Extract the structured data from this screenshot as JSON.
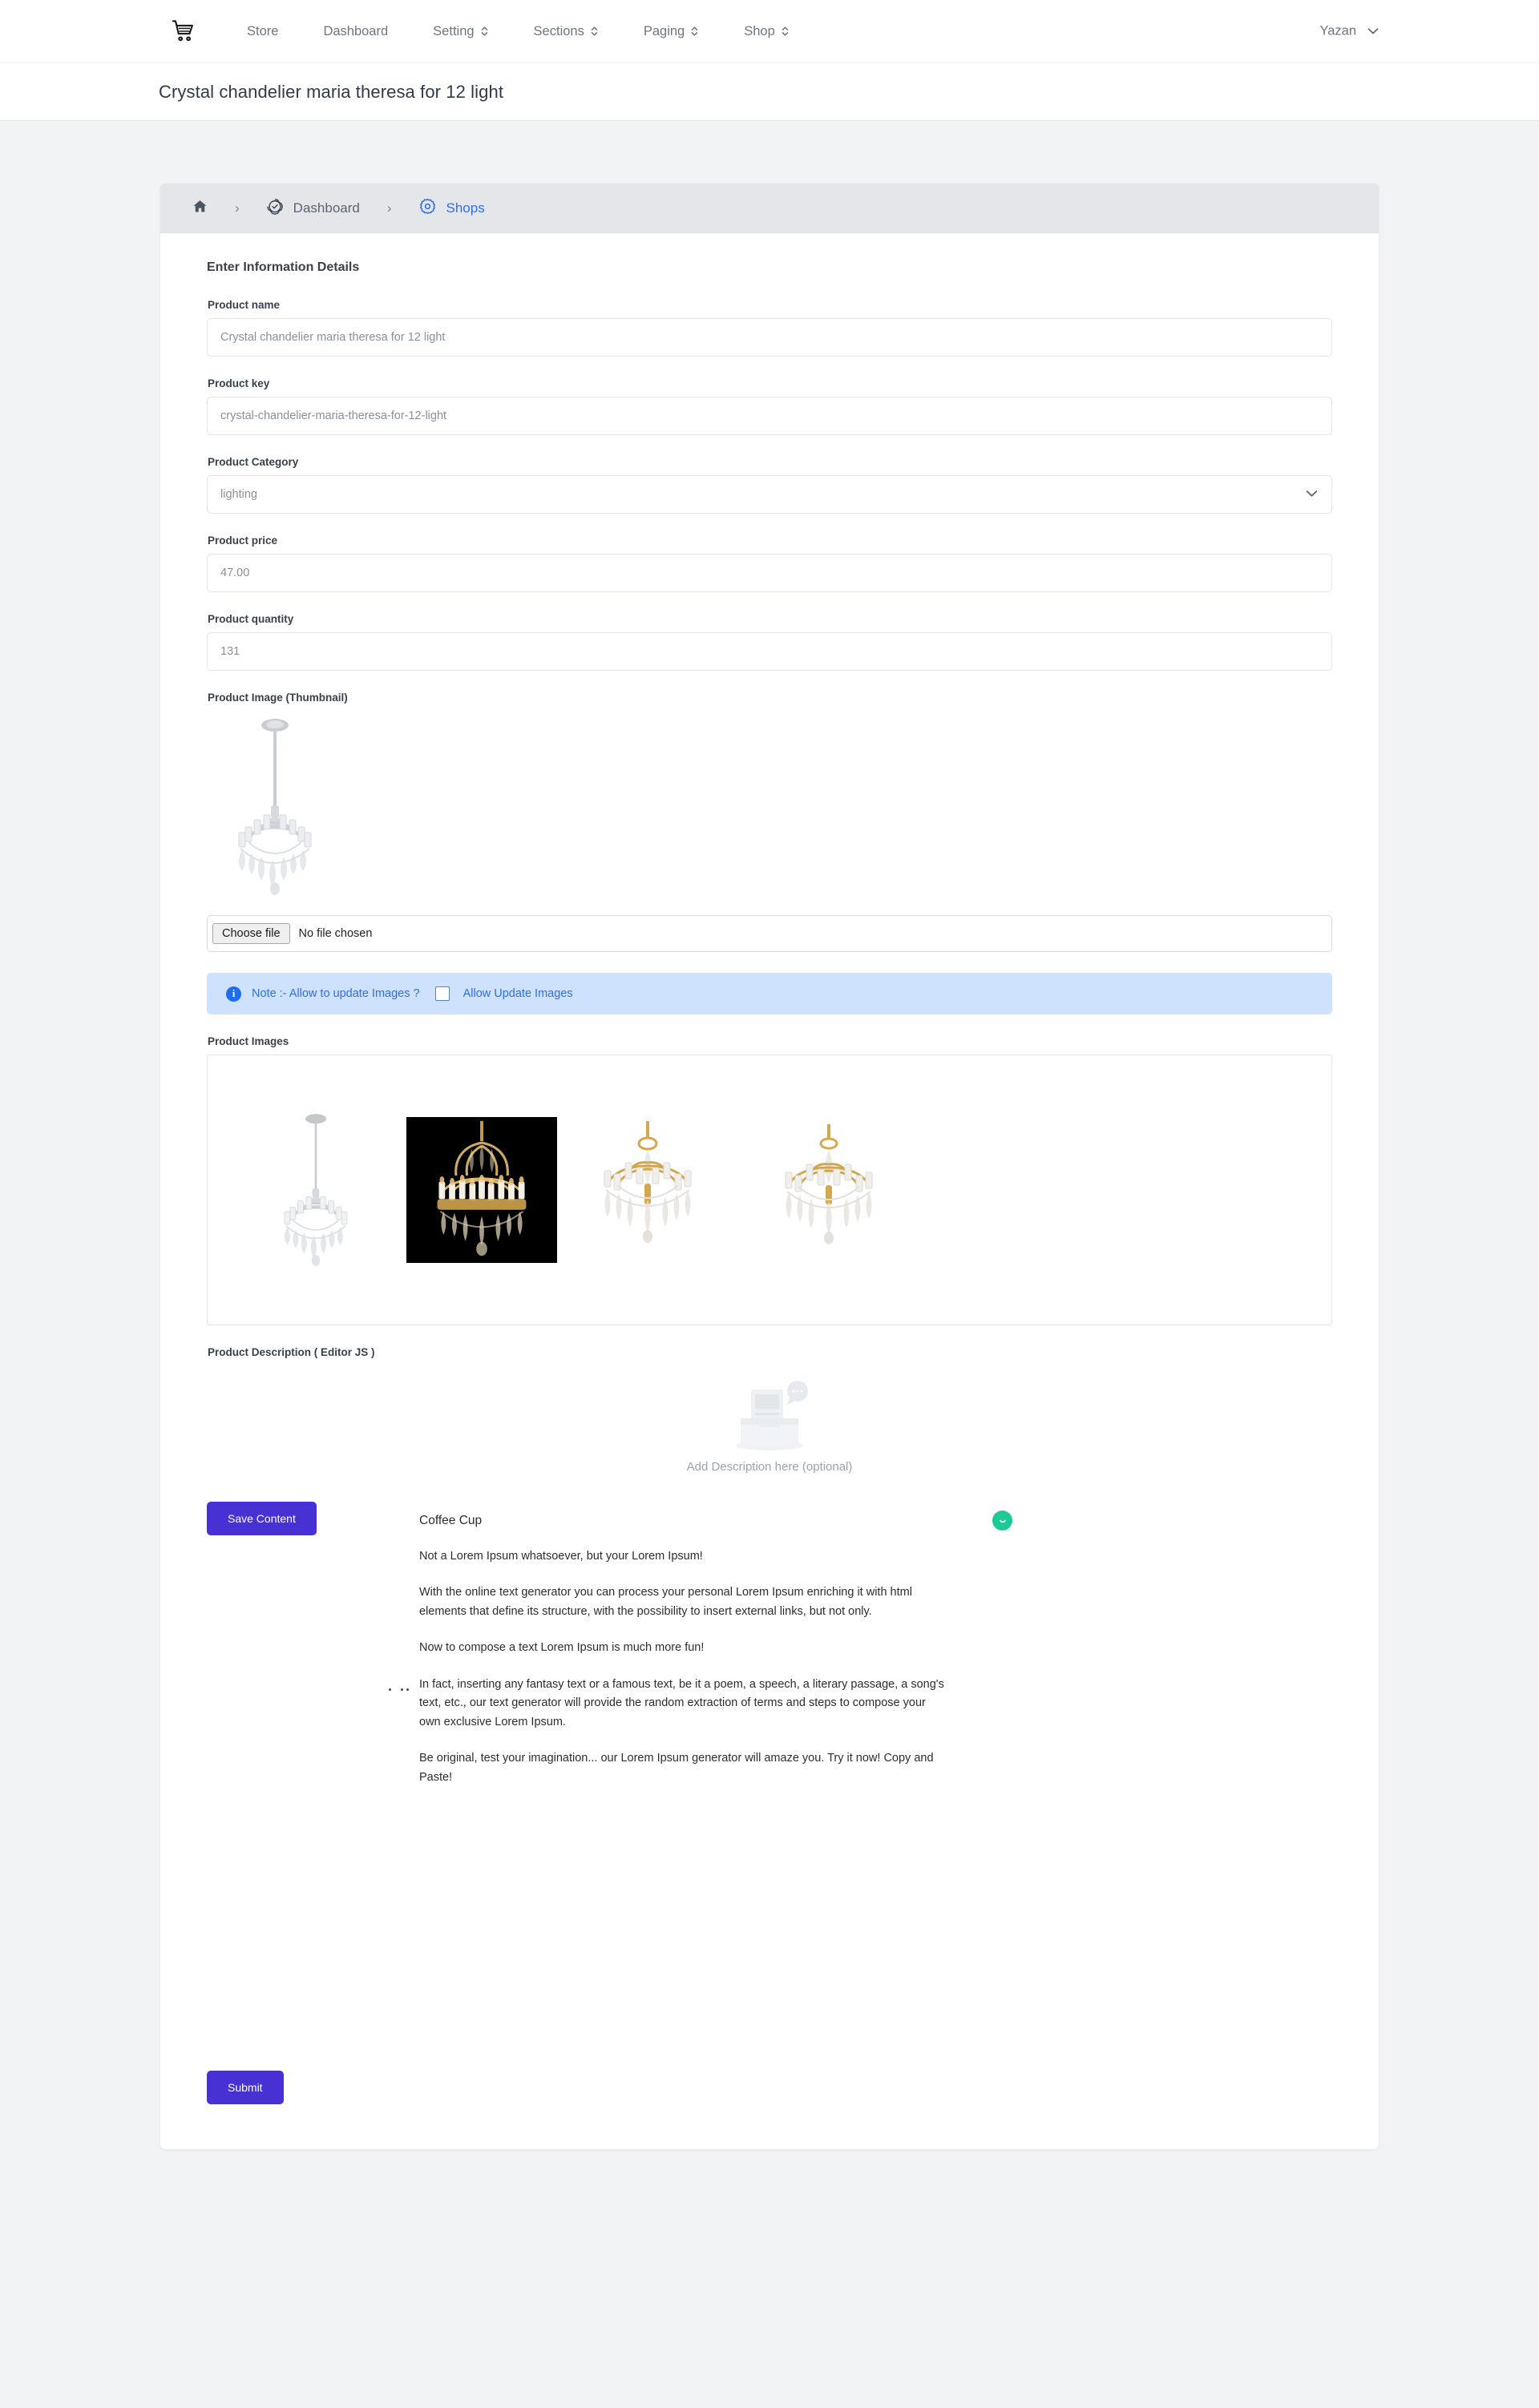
{
  "navbar": {
    "brand_icon": "shopping-cart-icon",
    "links": [
      {
        "label": "Store",
        "icon": null
      },
      {
        "label": "Dashboard",
        "icon": null
      },
      {
        "label": "Setting",
        "icon": "sort-updown-icon"
      },
      {
        "label": "Sections",
        "icon": "sort-updown-icon"
      },
      {
        "label": "Paging",
        "icon": "sort-updown-icon"
      },
      {
        "label": "Shop",
        "icon": "sort-updown-icon"
      }
    ],
    "user": {
      "name": "Yazan",
      "icon": "chevron-down-icon"
    }
  },
  "titlebar": {
    "title": "Crystal chandelier maria theresa for 12 light"
  },
  "breadcrumb": {
    "items": [
      {
        "label": "",
        "icon": "home-icon",
        "active": false
      },
      {
        "label": "Dashboard",
        "icon": "check-badge-icon",
        "active": false
      },
      {
        "label": "Shops",
        "icon": "gear-icon",
        "active": true
      }
    ],
    "separator": "›"
  },
  "form": {
    "section_title": "Enter Information Details",
    "fields": {
      "product_name": {
        "label": "Product name",
        "value": "Crystal chandelier maria theresa for 12 light",
        "placeholder": "Product name"
      },
      "product_key": {
        "label": "Product key",
        "value": "crystal-chandelier-maria-theresa-for-12-light",
        "placeholder": "Product key"
      },
      "product_category": {
        "label": "Product Category",
        "value": "lighting",
        "options": [
          "lighting"
        ]
      },
      "product_price": {
        "label": "Product price",
        "value": "47.00",
        "placeholder": "Product price"
      },
      "product_quantity": {
        "label": "Product quantity",
        "value": "131",
        "placeholder": "Product quantity"
      },
      "product_thumbnail": {
        "label": "Product Image (Thumbnail)",
        "choose_label": "Choose file",
        "status": "No file chosen"
      }
    },
    "note": {
      "icon": "info-icon",
      "text": "Note :- Allow to update Images ?",
      "checkbox_label": "Allow Update Images",
      "checked": false,
      "bg_color": "#cfe2fd",
      "text_color": "#2f6ef0"
    },
    "product_images": {
      "label": "Product Images",
      "items": [
        {
          "alt": "clear crystal chandelier on chain",
          "bg": "#ffffff"
        },
        {
          "alt": "gold crystal chandelier on black background",
          "bg": "#000000"
        },
        {
          "alt": "gold maria theresa chandelier",
          "bg": "#ffffff"
        },
        {
          "alt": "gold maria theresa chandelier variant",
          "bg": "#ffffff"
        }
      ]
    },
    "description": {
      "label": "Product Description ( Editor JS )",
      "placeholder_icon": "document-tray-icon",
      "placeholder_text": "Add Description here (optional)",
      "save_label": "Save Content",
      "heading": "Coffee Cup",
      "badge_icon": "smile-badge-icon",
      "badge_color": "#1ec997",
      "paragraphs": [
        "Not a Lorem Ipsum whatsoever, but your Lorem Ipsum!",
        "With the online text generator you can process your personal Lorem Ipsum enriching it with html elements that define its structure, with the possibility to insert external links, but not only.",
        "Now to compose a text Lorem Ipsum is much more fun!",
        "In fact, inserting any fantasy text or a famous text, be it a poem, a speech, a literary passage, a song's text, etc., our text generator will provide the random extraction of terms and steps to compose your own exclusive Lorem Ipsum.",
        "Be original, test your imagination... our Lorem Ipsum generator will amaze you. Try it now! Copy and Paste!"
      ]
    },
    "submit_label": "Submit",
    "accent_color": "#4731d3"
  }
}
